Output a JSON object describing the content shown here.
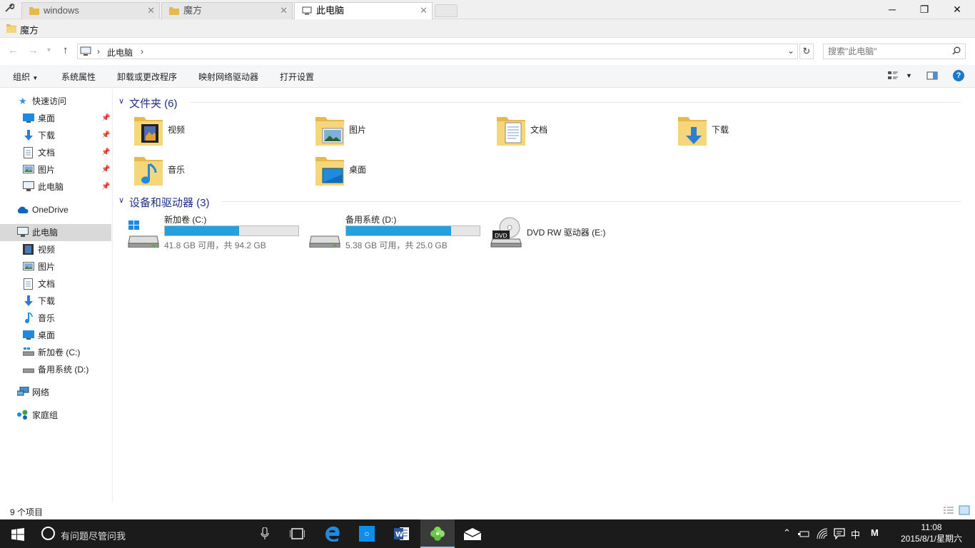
{
  "tabs": [
    {
      "label": "windows"
    },
    {
      "label": "魔方"
    },
    {
      "label": "此电脑"
    }
  ],
  "window_title": "魔方",
  "address": {
    "breadcrumb": "此电脑",
    "search_placeholder": "搜索\"此电脑\""
  },
  "toolbar": {
    "organize": "组织",
    "system_properties": "系统属性",
    "uninstall": "卸载或更改程序",
    "map_drive": "映射网络驱动器",
    "open_settings": "打开设置"
  },
  "sidebar": {
    "quick_access": "快速访问",
    "quick_items": [
      {
        "label": "桌面",
        "icon": "desktop-icon"
      },
      {
        "label": "下载",
        "icon": "download-icon"
      },
      {
        "label": "文档",
        "icon": "document-icon"
      },
      {
        "label": "图片",
        "icon": "picture-icon"
      },
      {
        "label": "此电脑",
        "icon": "computer-icon"
      }
    ],
    "onedrive": "OneDrive",
    "this_pc": "此电脑",
    "pc_items": [
      {
        "label": "视频",
        "icon": "video-icon"
      },
      {
        "label": "图片",
        "icon": "picture-icon"
      },
      {
        "label": "文档",
        "icon": "document-icon"
      },
      {
        "label": "下载",
        "icon": "download-icon"
      },
      {
        "label": "音乐",
        "icon": "music-icon"
      },
      {
        "label": "桌面",
        "icon": "desktop-icon"
      },
      {
        "label": "新加卷 (C:)",
        "icon": "drive-c-icon"
      },
      {
        "label": "备用系统 (D:)",
        "icon": "drive-d-icon"
      }
    ],
    "network": "网络",
    "homegroup": "家庭组"
  },
  "main": {
    "folders_header": "文件夹 (6)",
    "folders": [
      {
        "label": "视频",
        "icon": "video-folder-icon"
      },
      {
        "label": "图片",
        "icon": "picture-folder-icon"
      },
      {
        "label": "文档",
        "icon": "document-folder-icon"
      },
      {
        "label": "下载",
        "icon": "download-folder-icon"
      },
      {
        "label": "音乐",
        "icon": "music-folder-icon"
      },
      {
        "label": "桌面",
        "icon": "desktop-folder-icon"
      }
    ],
    "devices_header": "设备和驱动器 (3)",
    "drives": [
      {
        "name": "新加卷 (C:)",
        "free": "41.8 GB 可用，共 94.2 GB",
        "used_fraction": 0.556
      },
      {
        "name": "备用系统 (D:)",
        "free": "5.38 GB 可用，共 25.0 GB",
        "used_fraction": 0.785
      },
      {
        "name": "DVD RW 驱动器 (E:)"
      }
    ]
  },
  "status": {
    "count": "9 个项目"
  },
  "taskbar": {
    "search_placeholder": "有问题尽管问我",
    "ime": "中",
    "ime_mode": "M",
    "time": "11:08",
    "date": "2015/8/1/星期六"
  },
  "colors": {
    "accent": "#1979ca",
    "bar_fill": "#26a0da",
    "header_blue": "#1e3287"
  }
}
